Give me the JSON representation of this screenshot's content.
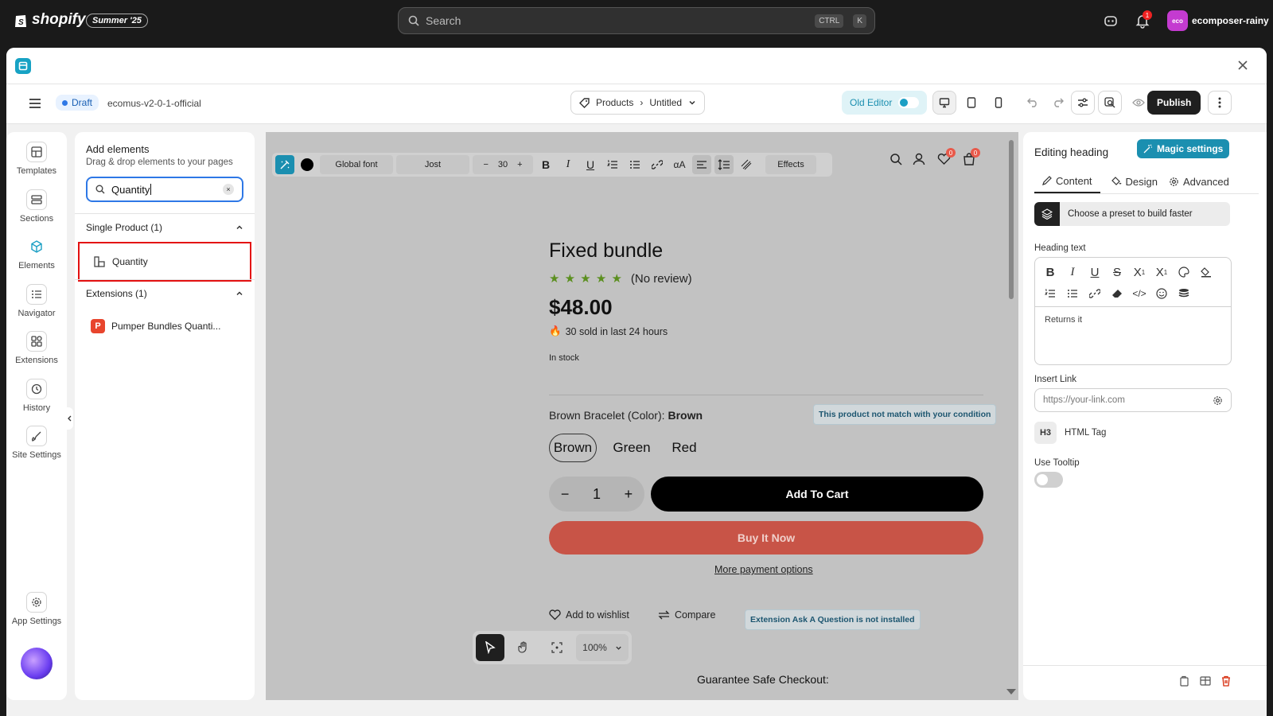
{
  "shopify": {
    "logo": "shopify",
    "edition": "Summer '25",
    "search_placeholder": "Search",
    "kbd1": "CTRL",
    "kbd2": "K",
    "notif_count": "1",
    "avatar_text": "eco",
    "store_name": "ecomposer-rainy"
  },
  "appbar": {
    "status": "Draft",
    "store_slug": "ecomus-v2-0-1-official",
    "breadcrumb_type": "Products",
    "breadcrumb_page": "Untitled",
    "old_editor": "Old Editor",
    "publish": "Publish"
  },
  "rail": {
    "items": [
      {
        "label": "Templates"
      },
      {
        "label": "Sections"
      },
      {
        "label": "Elements"
      },
      {
        "label": "Navigator"
      },
      {
        "label": "Extensions"
      },
      {
        "label": "History"
      },
      {
        "label": "Site Settings"
      }
    ],
    "app_settings": "App Settings"
  },
  "panel": {
    "title": "Add elements",
    "subtitle": "Drag & drop elements to your pages",
    "search_value": "Quantity",
    "group1": "Single Product (1)",
    "item1": "Quantity",
    "group2": "Extensions (1)",
    "item2": "Pumper Bundles Quanti..."
  },
  "toolbar": {
    "font": "Global font",
    "family": "Jost",
    "size": "30",
    "effects": "Effects"
  },
  "store_header": {
    "wishlist_count": "0",
    "cart_count": "0"
  },
  "product": {
    "title": "Fixed bundle",
    "stars": "★ ★ ★ ★ ★",
    "reviews": "(No review)",
    "price": "$48.00",
    "sold": "30 sold in last 24 hours",
    "stock": "In stock",
    "option_label": "Brown Bracelet (Color):",
    "option_value": "Brown",
    "condition_note": "This product not match with your condition",
    "variants": [
      "Brown",
      "Green",
      "Red"
    ],
    "qty": "1",
    "add_to_cart": "Add To Cart",
    "buy_now": "Buy It Now",
    "more_payment": "More payment options",
    "wishlist": "Add to wishlist",
    "compare": "Compare",
    "ask_question_note": "Extension Ask A Question is not installed",
    "guarantee": "Guarantee Safe Checkout:"
  },
  "zoom": {
    "level": "100%"
  },
  "rpanel": {
    "title": "Editing heading",
    "magic": "Magic settings",
    "tab_content": "Content",
    "tab_design": "Design",
    "tab_advanced": "Advanced",
    "preset": "Choose a preset to build faster",
    "heading_label": "Heading text",
    "heading_value": "Returns it",
    "link_label": "Insert Link",
    "link_placeholder": "https://your-link.com",
    "tag_badge": "H3",
    "tag_label": "HTML Tag",
    "tooltip_label": "Use Tooltip"
  }
}
